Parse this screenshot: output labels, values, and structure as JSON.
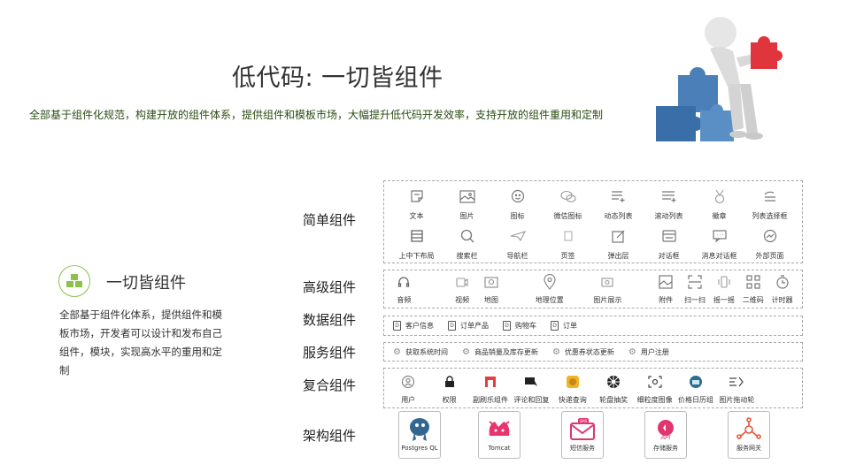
{
  "title": "低代码: 一切皆组件",
  "subtitle": "全部基于组件化规范，构建开放的组件体系，提供组件和模板市场，大幅提升低代码开发效率，支持开放的组件重用和定制",
  "feature": {
    "title": "一切皆组件",
    "desc": "全部基于组件化体系，提供组件和模板市场，开发者可以设计和发布自己组件，模块，实现高水平的重用和定制"
  },
  "categories": {
    "simple": "简单组件",
    "advanced": "高级组件",
    "data": "数据组件",
    "service": "服务组件",
    "composite": "复合组件",
    "architecture": "架构组件"
  },
  "simple_items": [
    {
      "label": "文本",
      "icon": "note-icon"
    },
    {
      "label": "图片",
      "icon": "image-icon"
    },
    {
      "label": "图标",
      "icon": "smile-icon"
    },
    {
      "label": "微信图标",
      "icon": "wechat-icon"
    },
    {
      "label": "动态列表",
      "icon": "list-add-icon"
    },
    {
      "label": "滚动列表",
      "icon": "scroll-list-icon"
    },
    {
      "label": "徽章",
      "icon": "medal-icon"
    },
    {
      "label": "列表选择框",
      "icon": "list-select-icon"
    },
    {
      "label": "上中下布局",
      "icon": "layout-icon"
    },
    {
      "label": "搜索栏",
      "icon": "search-icon"
    },
    {
      "label": "导航栏",
      "icon": "send-icon"
    },
    {
      "label": "页签",
      "icon": "bookmark-icon"
    },
    {
      "label": "弹出层",
      "icon": "edit-icon"
    },
    {
      "label": "对话框",
      "icon": "dialog-icon"
    },
    {
      "label": "消息对话框",
      "icon": "message-icon"
    },
    {
      "label": "外部页面",
      "icon": "chart-icon"
    }
  ],
  "advanced_items": [
    {
      "label": "音频",
      "icon": "headphone-icon"
    },
    {
      "label": "视频",
      "icon": "video-icon"
    },
    {
      "label": "地图",
      "icon": "map-icon"
    },
    {
      "label": "地理位置",
      "icon": "location-icon"
    },
    {
      "label": "图片展示",
      "icon": "gallery-icon"
    },
    {
      "label": "附件",
      "icon": "attachment-icon"
    },
    {
      "label": "扫一扫",
      "icon": "scan-icon"
    },
    {
      "label": "摇一摇",
      "icon": "shake-icon"
    },
    {
      "label": "二维码",
      "icon": "qrcode-icon"
    },
    {
      "label": "计时器",
      "icon": "timer-icon"
    }
  ],
  "data_items": [
    "客户信息",
    "订单产品",
    "购物车",
    "订单"
  ],
  "service_items": [
    "获取系统时间",
    "商品销量及库存更新",
    "优惠券状态更新",
    "用户注册"
  ],
  "composite_items": [
    {
      "label": "用户",
      "icon": "user-icon"
    },
    {
      "label": "权限",
      "icon": "lock-icon"
    },
    {
      "label": "副刷乐组件",
      "icon": "app-icon"
    },
    {
      "label": "评论和回复",
      "icon": "comment-icon"
    },
    {
      "label": "快递查询",
      "icon": "express-icon"
    },
    {
      "label": "轮盘抽奖",
      "icon": "wheel-icon"
    },
    {
      "label": "细粒度图像",
      "icon": "image-grain-icon"
    },
    {
      "label": "价格日历组",
      "icon": "calendar-icon"
    },
    {
      "label": "图片拖动轮",
      "icon": "drag-icon"
    }
  ],
  "architecture_items": [
    {
      "label": "Postgres QL",
      "icon": "postgresql-icon"
    },
    {
      "label": "Tomcat",
      "icon": "tomcat-icon"
    },
    {
      "label": "短信服务",
      "icon": "sms-icon"
    },
    {
      "label": "存储服务",
      "icon": "api-icon"
    },
    {
      "label": "服务网关",
      "icon": "gateway-icon"
    }
  ],
  "colors": {
    "accent_green": "#8bc34a",
    "subtitle_green": "#2a4d12",
    "puzzle_blue": "#3a6ea8",
    "puzzle_red": "#e0353c"
  }
}
